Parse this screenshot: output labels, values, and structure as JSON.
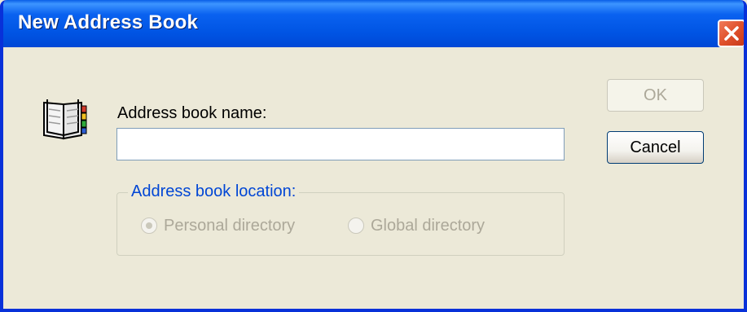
{
  "window": {
    "title": "New Address Book"
  },
  "form": {
    "name_label": "Address book name:",
    "name_value": "",
    "location_legend": "Address book location:",
    "options": [
      {
        "label": "Personal directory",
        "checked": true,
        "enabled": false
      },
      {
        "label": "Global directory",
        "checked": false,
        "enabled": false
      }
    ]
  },
  "buttons": {
    "ok_label": "OK",
    "ok_enabled": false,
    "cancel_label": "Cancel"
  },
  "colors": {
    "titlebar": "#0054e3",
    "dialog_bg": "#ece9d8",
    "legend_text": "#0046d5",
    "disabled_text": "#aca899"
  },
  "icons": {
    "dialog_icon": "address-book-icon",
    "close": "close-icon"
  }
}
